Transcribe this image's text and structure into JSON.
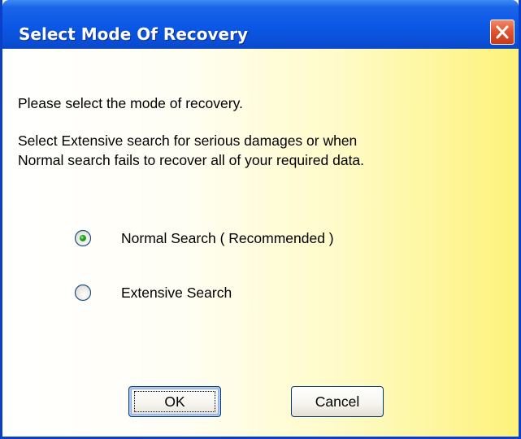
{
  "window": {
    "title": "Select Mode Of Recovery",
    "close_icon": "close-x-icon",
    "colors": {
      "titlebar": "#0a58e5",
      "close_button": "#e2552f",
      "client_gradient_start": "#ffffff",
      "client_gradient_end": "#fdf27a"
    }
  },
  "content": {
    "intro": "Please select the mode of recovery.",
    "description_line1": "Select Extensive search for serious damages or when",
    "description_line2": "Normal search fails to recover all of your required data."
  },
  "options": [
    {
      "label": "Normal Search ( Recommended )",
      "checked": true
    },
    {
      "label": "Extensive Search",
      "checked": false
    }
  ],
  "buttons": {
    "ok_label": "OK",
    "cancel_label": "Cancel"
  }
}
